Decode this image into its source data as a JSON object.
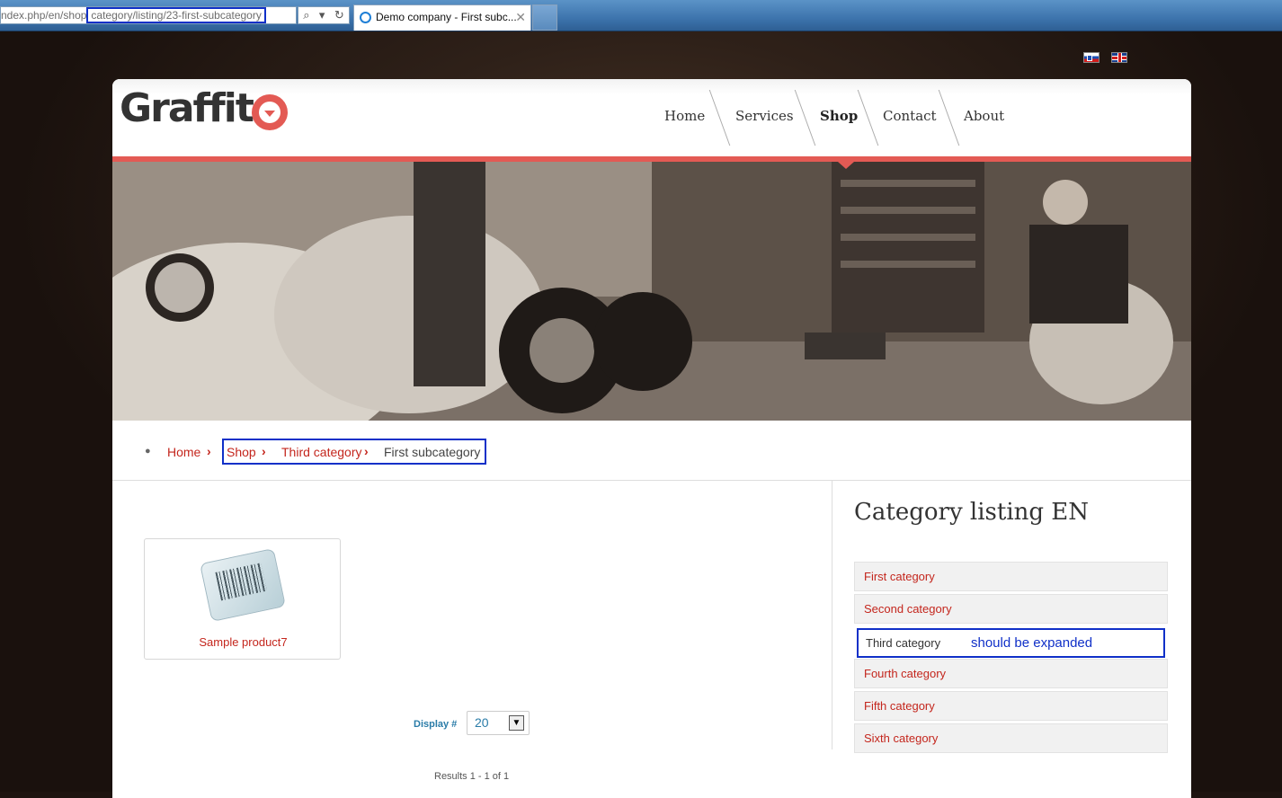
{
  "browser": {
    "address_pre": "ndex.php/en/shop",
    "address_selected": "category/listing/23-first-subcategory",
    "tools": [
      "⌕",
      "▾",
      "↻"
    ],
    "tab_title": "Demo company - First subc...",
    "tab_close": "✕"
  },
  "languages": [
    "sl",
    "en"
  ],
  "site": {
    "logo": "Graffit",
    "nav": [
      {
        "label": "Home"
      },
      {
        "label": "Services"
      },
      {
        "label": "Shop",
        "active": true
      },
      {
        "label": "Contact"
      },
      {
        "label": "About"
      }
    ]
  },
  "breadcrumb": {
    "home": "Home",
    "items": [
      "Shop",
      "Third category",
      "First subcategory"
    ],
    "separator": "›"
  },
  "products": [
    {
      "name": "Sample product7"
    }
  ],
  "pagination": {
    "display_label": "Display #",
    "display_value": "20",
    "results": "Results 1 - 1 of 1"
  },
  "sidebar": {
    "title": "Category listing EN",
    "categories": [
      {
        "label": "First category"
      },
      {
        "label": "Second category"
      },
      {
        "label": "Third category",
        "current": true,
        "note": "should be expanded"
      },
      {
        "label": "Fourth category"
      },
      {
        "label": "Fifth category"
      },
      {
        "label": "Sixth category"
      }
    ]
  },
  "colors": {
    "accent": "#e35a54",
    "link": "#c4261d",
    "annotation": "#1030c8"
  }
}
